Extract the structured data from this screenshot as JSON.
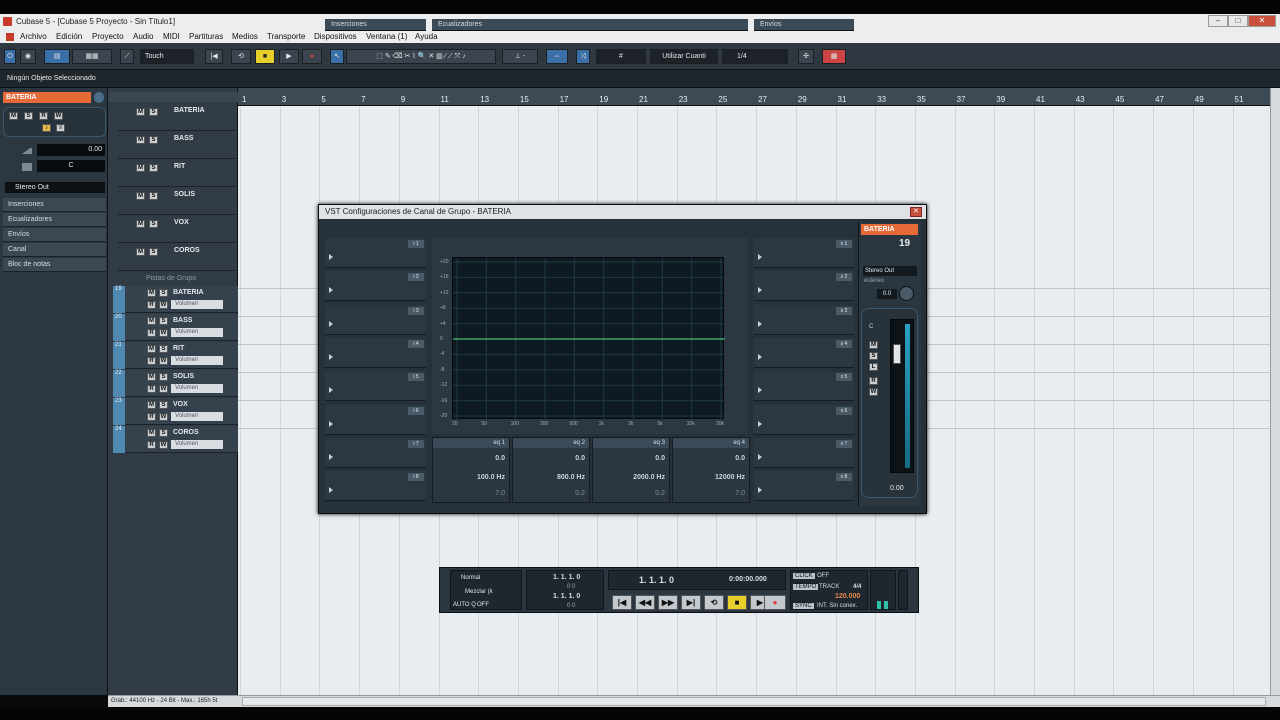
{
  "window": {
    "title": "Cubase 5 - [Cubase 5 Proyecto - Sin Título1]",
    "controls": [
      "–",
      "□",
      "✕"
    ]
  },
  "menu": [
    "Archivo",
    "Edición",
    "Proyecto",
    "Audio",
    "MIDI",
    "Partituras",
    "Medios",
    "Transporte",
    "Dispositivos",
    "Ventana (1)",
    "Ayuda"
  ],
  "toolbar": {
    "automation_mode": "Touch",
    "grid_label": "#",
    "quantize_label": "Utilizar Cuanti",
    "quantize_value": "1/4"
  },
  "info_line": "Ningún Objeto Seleccionado",
  "inspector": {
    "track_name": "BATERIA",
    "volume": "0.00",
    "pan": "C",
    "output": "Stereo Out",
    "sections": [
      "Inserciones",
      "Ecualizadores",
      "Envíos",
      "Canal",
      "Bloc de notas"
    ]
  },
  "group_tracks": [
    {
      "name": "BATERIA",
      "color": "#e55a3a"
    },
    {
      "name": "BASS",
      "color": "#6a4fa0"
    },
    {
      "name": "RIT",
      "color": "#4aa05a"
    },
    {
      "name": "SOLIS",
      "color": "#e6d24a"
    },
    {
      "name": "VOX",
      "color": "#e6674a"
    },
    {
      "name": "COROS",
      "color": "#d65a7a"
    }
  ],
  "folder_label": "Pistas de Grupo",
  "audio_tracks": [
    {
      "num": "19",
      "name": "BATERIA",
      "vol": "Volumen",
      "color": "#e55a3a"
    },
    {
      "num": "20",
      "name": "BASS",
      "vol": "Volumen",
      "color": "#6a4fa0"
    },
    {
      "num": "21",
      "name": "RIT",
      "vol": "Volumen",
      "color": "#4aa05a"
    },
    {
      "num": "22",
      "name": "SOLIS",
      "vol": "Volumen",
      "color": "#e6d24a"
    },
    {
      "num": "23",
      "name": "VOX",
      "vol": "Volumen",
      "color": "#e6674a"
    },
    {
      "num": "24",
      "name": "COROS",
      "vol": "Volumen",
      "color": "#d65a7a"
    }
  ],
  "ruler": [
    "1",
    "3",
    "5",
    "7",
    "9",
    "11",
    "13",
    "15",
    "17",
    "19",
    "21",
    "23",
    "25",
    "27",
    "29",
    "31",
    "33",
    "35",
    "37",
    "39",
    "41",
    "43",
    "45",
    "47",
    "49",
    "51"
  ],
  "vst": {
    "title": "VST Configuraciones de Canal de Grupo - BATERIA",
    "inserts_label": "Inserciones",
    "eq_label": "Ecualizadores",
    "sends_label": "Envíos",
    "insert_tags": [
      "i 1",
      "i 2",
      "i 3",
      "i 4",
      "i 5",
      "i 6",
      "i 7",
      "i 8"
    ],
    "send_tags": [
      "s 1",
      "s 2",
      "s 3",
      "s 4",
      "s 5",
      "s 6",
      "s 7",
      "s 8"
    ],
    "eq_y_labels": [
      "+20",
      "+16",
      "+12",
      "+8",
      "+4",
      "0",
      "-4",
      "-8",
      "-12",
      "-16",
      "-20"
    ],
    "eq_x_labels": [
      "20",
      "50",
      "100",
      "200",
      "500",
      "1k",
      "2k",
      "5k",
      "10k",
      "20k"
    ],
    "eq_bands": [
      {
        "name": "eq 1",
        "gain": "0.0",
        "freq": "100.0 Hz",
        "q": "7.0"
      },
      {
        "name": "eq 2",
        "gain": "0.0",
        "freq": "800.0 Hz",
        "q": "0.2"
      },
      {
        "name": "eq 3",
        "gain": "0.0",
        "freq": "2000.0 Hz",
        "q": "0.2"
      },
      {
        "name": "eq 4",
        "gain": "0.0",
        "freq": "12000 Hz",
        "q": "7.0"
      }
    ],
    "strip": {
      "name": "BATERIA",
      "number": "19",
      "output": "Stereo Out",
      "mode": "estéreo",
      "pan_value": "0.0",
      "pan_c": "C",
      "fader_value": "0.00"
    }
  },
  "transport": {
    "mode1": "Normal",
    "mode2": "Mezclar (k",
    "auto_q": "AUTO Q",
    "auto_q_state": "OFF",
    "locator_left": "1. 1. 1. 0",
    "locator_left_sub": "0  0",
    "locator_right": "1. 1. 1. 0",
    "locator_right_sub": "0  0",
    "position_bars": "1. 1. 1.  0",
    "position_time": "0:00:00.000",
    "click_label": "CLICK",
    "click_state": "OFF",
    "tempo_label": "TEMPO",
    "tempo_mode": "TRACK",
    "signature": "4/4",
    "tempo": "120.000",
    "sync_label": "SYNC",
    "sync_state": "INT. Sin conex."
  },
  "status": "Grab.: 44100 Hz - 24 Bit - Max.: 165h 5t"
}
